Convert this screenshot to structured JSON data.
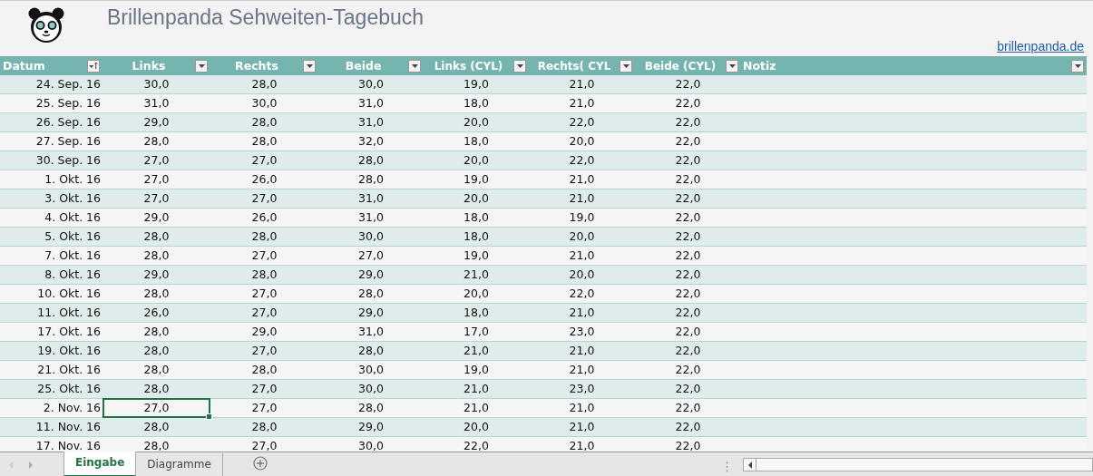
{
  "title": "Brillenpanda Sehweiten-Tagebuch",
  "link": "brillenpanda.de",
  "table": {
    "columns": [
      {
        "label": "Datum",
        "kind": "sort"
      },
      {
        "label": "Links",
        "kind": "filter"
      },
      {
        "label": "Rechts",
        "kind": "filter"
      },
      {
        "label": "Beide",
        "kind": "filter"
      },
      {
        "label": "Links (CYL)",
        "kind": "filter"
      },
      {
        "label": "Rechts( CYL",
        "kind": "filter"
      },
      {
        "label": "Beide (CYL)",
        "kind": "filter"
      },
      {
        "label": "Notiz",
        "kind": "filter"
      }
    ],
    "rows": [
      {
        "cells": [
          "24. Sep. 16",
          "30,0",
          "28,0",
          "30,0",
          "19,0",
          "21,0",
          "22,0"
        ],
        "selected": [
          false,
          false,
          false,
          false,
          false,
          false,
          false
        ]
      },
      {
        "cells": [
          "25. Sep. 16",
          "31,0",
          "30,0",
          "31,0",
          "18,0",
          "21,0",
          "22,0"
        ],
        "selected": [
          false,
          false,
          false,
          false,
          false,
          false,
          false
        ]
      },
      {
        "cells": [
          "26. Sep. 16",
          "29,0",
          "28,0",
          "31,0",
          "20,0",
          "22,0",
          "22,0"
        ],
        "selected": [
          false,
          false,
          false,
          false,
          false,
          false,
          false
        ]
      },
      {
        "cells": [
          "27. Sep. 16",
          "28,0",
          "28,0",
          "32,0",
          "18,0",
          "20,0",
          "22,0"
        ],
        "selected": [
          false,
          false,
          false,
          false,
          false,
          false,
          false
        ]
      },
      {
        "cells": [
          "30. Sep. 16",
          "27,0",
          "27,0",
          "28,0",
          "20,0",
          "22,0",
          "22,0"
        ],
        "selected": [
          false,
          false,
          false,
          false,
          false,
          false,
          false
        ]
      },
      {
        "cells": [
          "1. Okt. 16",
          "27,0",
          "26,0",
          "28,0",
          "19,0",
          "21,0",
          "22,0"
        ],
        "selected": [
          false,
          false,
          false,
          false,
          false,
          false,
          false
        ]
      },
      {
        "cells": [
          "3. Okt. 16",
          "27,0",
          "27,0",
          "31,0",
          "20,0",
          "21,0",
          "22,0"
        ],
        "selected": [
          false,
          false,
          false,
          false,
          false,
          false,
          false
        ]
      },
      {
        "cells": [
          "4. Okt. 16",
          "29,0",
          "26,0",
          "31,0",
          "18,0",
          "19,0",
          "22,0"
        ],
        "selected": [
          false,
          false,
          false,
          false,
          false,
          false,
          false
        ]
      },
      {
        "cells": [
          "5. Okt. 16",
          "28,0",
          "28,0",
          "30,0",
          "18,0",
          "20,0",
          "22,0"
        ],
        "selected": [
          false,
          false,
          false,
          false,
          false,
          false,
          false
        ]
      },
      {
        "cells": [
          "7. Okt. 16",
          "28,0",
          "27,0",
          "27,0",
          "19,0",
          "21,0",
          "22,0"
        ],
        "selected": [
          false,
          false,
          false,
          false,
          false,
          false,
          false
        ]
      },
      {
        "cells": [
          "8. Okt. 16",
          "29,0",
          "28,0",
          "29,0",
          "21,0",
          "20,0",
          "22,0"
        ],
        "selected": [
          false,
          false,
          false,
          false,
          false,
          false,
          false
        ]
      },
      {
        "cells": [
          "10. Okt. 16",
          "28,0",
          "27,0",
          "28,0",
          "20,0",
          "22,0",
          "22,0"
        ],
        "selected": [
          false,
          false,
          false,
          false,
          false,
          false,
          false
        ]
      },
      {
        "cells": [
          "11. Okt. 16",
          "26,0",
          "27,0",
          "29,0",
          "18,0",
          "21,0",
          "22,0"
        ],
        "selected": [
          false,
          false,
          false,
          false,
          false,
          false,
          false
        ]
      },
      {
        "cells": [
          "17. Okt. 16",
          "28,0",
          "29,0",
          "31,0",
          "17,0",
          "23,0",
          "22,0"
        ],
        "selected": [
          false,
          false,
          false,
          false,
          false,
          false,
          false
        ]
      },
      {
        "cells": [
          "19. Okt. 16",
          "28,0",
          "27,0",
          "28,0",
          "21,0",
          "21,0",
          "22,0"
        ],
        "selected": [
          false,
          false,
          false,
          false,
          false,
          false,
          false
        ]
      },
      {
        "cells": [
          "21. Okt. 16",
          "28,0",
          "28,0",
          "30,0",
          "19,0",
          "21,0",
          "22,0"
        ],
        "selected": [
          false,
          false,
          false,
          false,
          false,
          false,
          false
        ]
      },
      {
        "cells": [
          "25. Okt. 16",
          "28,0",
          "27,0",
          "30,0",
          "21,0",
          "23,0",
          "22,0"
        ],
        "selected": [
          false,
          false,
          false,
          false,
          false,
          false,
          false
        ]
      },
      {
        "cells": [
          "2. Nov. 16",
          "27,0",
          "27,0",
          "28,0",
          "21,0",
          "21,0",
          "22,0"
        ],
        "selected": [
          false,
          true,
          false,
          false,
          false,
          false,
          false
        ]
      },
      {
        "cells": [
          "11. Nov. 16",
          "28,0",
          "28,0",
          "29,0",
          "20,0",
          "21,0",
          "22,0"
        ],
        "selected": [
          false,
          false,
          false,
          false,
          false,
          false,
          false
        ]
      },
      {
        "cells": [
          "17. Nov. 16",
          "28,0",
          "27,0",
          "30,0",
          "22,0",
          "21,0",
          "22,0"
        ],
        "selected": [
          false,
          false,
          false,
          false,
          false,
          false,
          false
        ]
      }
    ]
  },
  "sheet_tabs": [
    {
      "label": "Eingabe",
      "selected": true
    },
    {
      "label": "Diagramme",
      "selected": false
    }
  ]
}
